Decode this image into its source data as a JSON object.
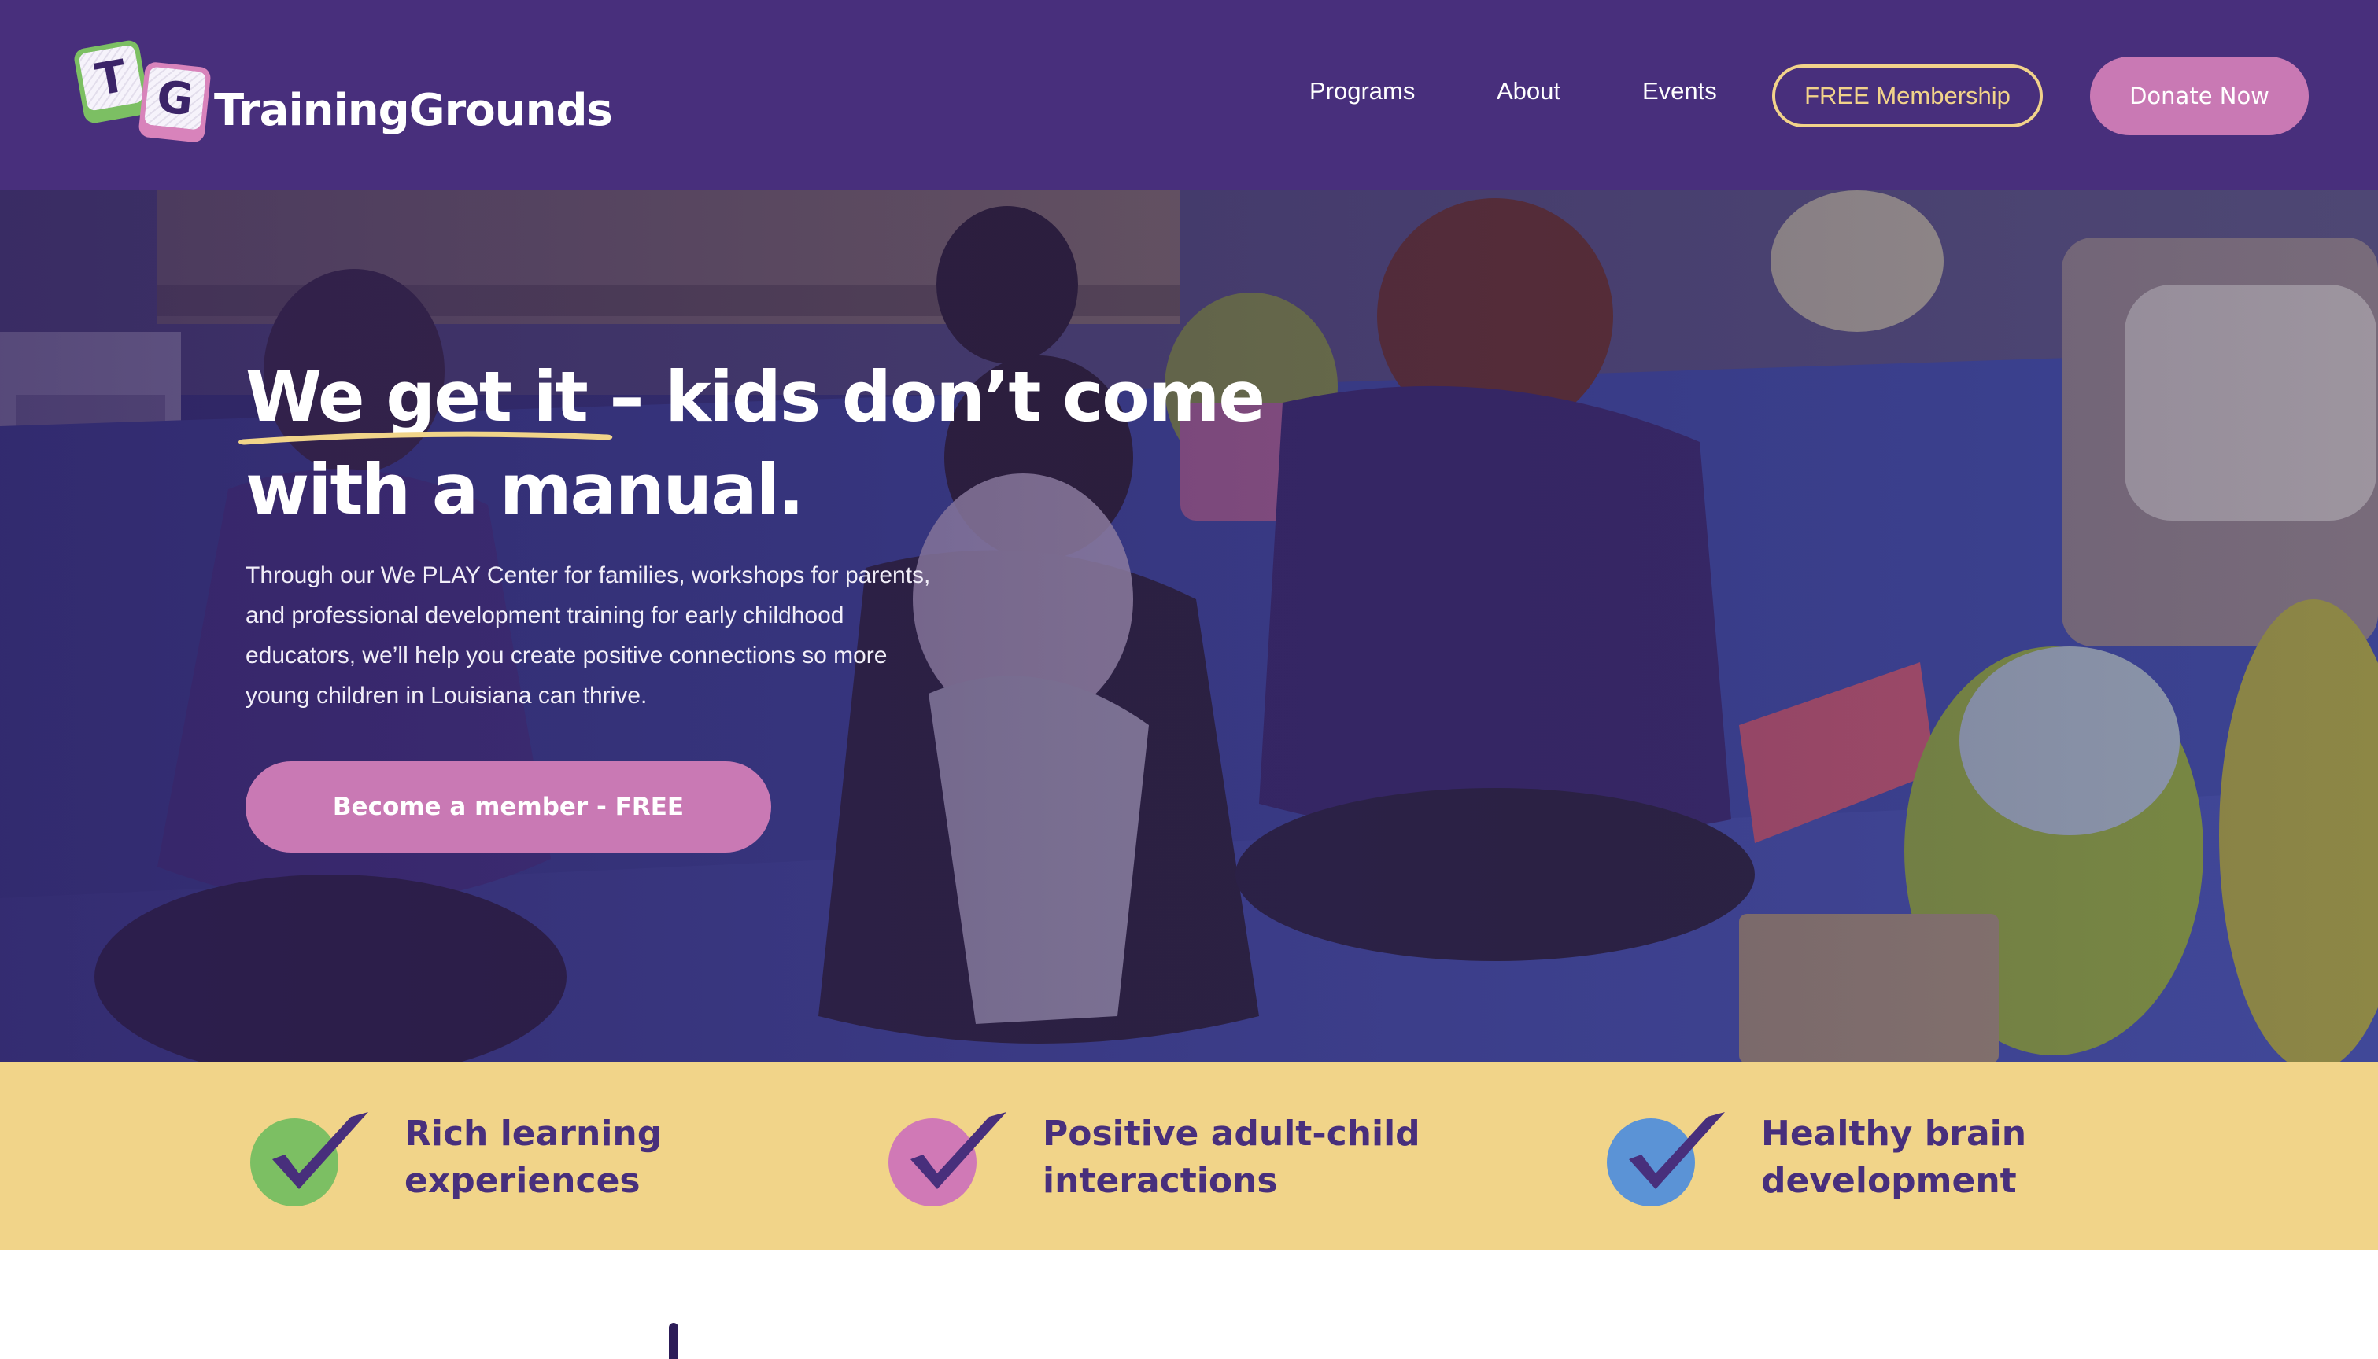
{
  "colors": {
    "header_bg": "#482f7c",
    "accent_pink": "#c979b4",
    "accent_yellow": "#f1d489",
    "outline_gold": "#f2d38a",
    "text_purple": "#482f7c",
    "check_green": "#7cbf63",
    "check_pink": "#d079b6",
    "check_blue": "#5b93d6"
  },
  "header": {
    "logo": {
      "block_t": "T",
      "block_g": "G",
      "text": "TrainingGrounds",
      "icon": "letter-blocks-logo"
    },
    "nav": [
      {
        "label": "Programs"
      },
      {
        "label": "About"
      },
      {
        "label": "Events"
      }
    ],
    "membership_button": "FREE Membership",
    "donate_button": "Donate Now"
  },
  "hero": {
    "headline_highlight": "We get it",
    "headline_rest": " – kids don’t come with a manual.",
    "body": "Through our We PLAY Center for families, workshops for parents, and professional development training for early childhood educators, we’ll help you create positive connections so more young children in Louisiana can thrive.",
    "cta": "Become a member - FREE",
    "image": "photo of caregivers and babies playing on a blue carpet"
  },
  "features": [
    {
      "line1": "Rich learning",
      "line2": "experiences",
      "icon": "green-checkmark-icon"
    },
    {
      "line1": "Positive adult-child",
      "line2": "interactions",
      "icon": "pink-checkmark-icon"
    },
    {
      "line1": "Healthy brain",
      "line2": "development",
      "icon": "blue-checkmark-icon"
    }
  ]
}
